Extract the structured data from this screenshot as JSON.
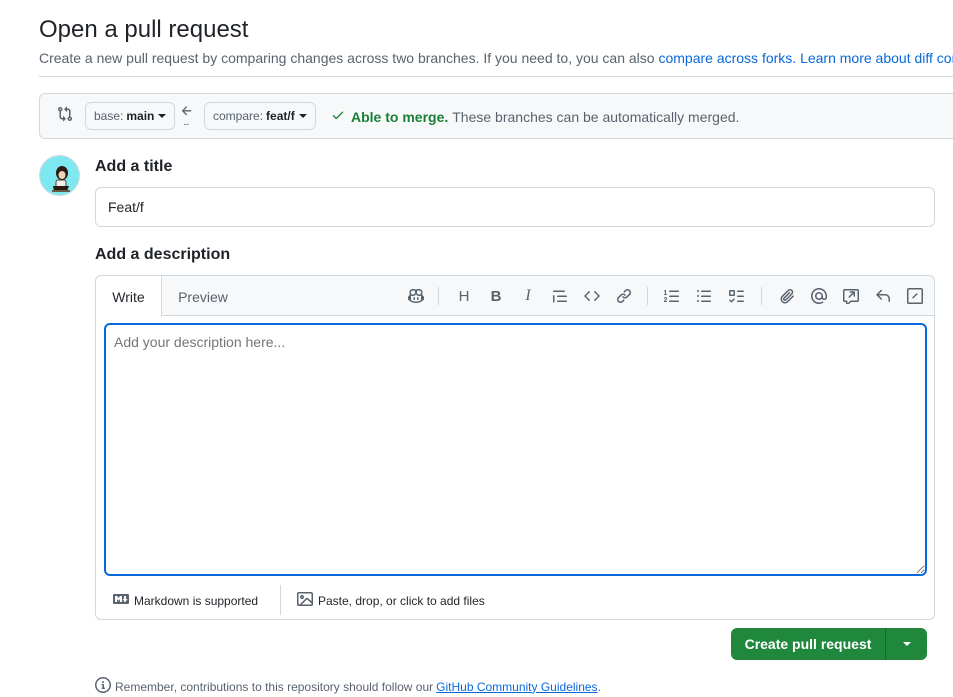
{
  "header": {
    "title": "Open a pull request",
    "subtitle_text": "Create a new pull request by comparing changes across two branches. If you need to, you can also",
    "compare_forks_link": "compare across forks.",
    "learn_more_link": "Learn more about diff com"
  },
  "range": {
    "base_prefix": "base:",
    "base_branch": "main",
    "compare_prefix": "compare:",
    "compare_branch": "feat/f",
    "arrow_dots": "...",
    "merge_ok": "Able to merge.",
    "merge_msg": "These branches can be automatically merged."
  },
  "form": {
    "title_label": "Add a title",
    "title_value": "Feat/f",
    "description_label": "Add a description",
    "description_placeholder": "Add your description here..."
  },
  "editor": {
    "tabs": [
      {
        "label": "Write",
        "active": true
      },
      {
        "label": "Preview",
        "active": false
      }
    ],
    "toolbar": [
      "copilot-icon",
      "heading-icon",
      "bold-icon",
      "italic-icon",
      "quote-icon",
      "code-icon",
      "link-icon",
      "ordered-list-icon",
      "unordered-list-icon",
      "task-list-icon",
      "attach-icon",
      "mention-icon",
      "reference-icon",
      "reply-icon",
      "slash-command-icon"
    ],
    "heading_glyph": "H",
    "bold_glyph": "B",
    "italic_glyph": "I",
    "markdown_note": "Markdown is supported",
    "files_note": "Paste, drop, or click to add files"
  },
  "actions": {
    "create_label": "Create pull request"
  },
  "footer": {
    "reminder_text": "Remember, contributions to this repository should follow our",
    "guidelines_link": "GitHub Community Guidelines",
    "period": "."
  },
  "colors": {
    "accent": "#0969da",
    "success": "#1a7f37",
    "primary_button": "#1f883d",
    "border": "#d1d9e0"
  }
}
